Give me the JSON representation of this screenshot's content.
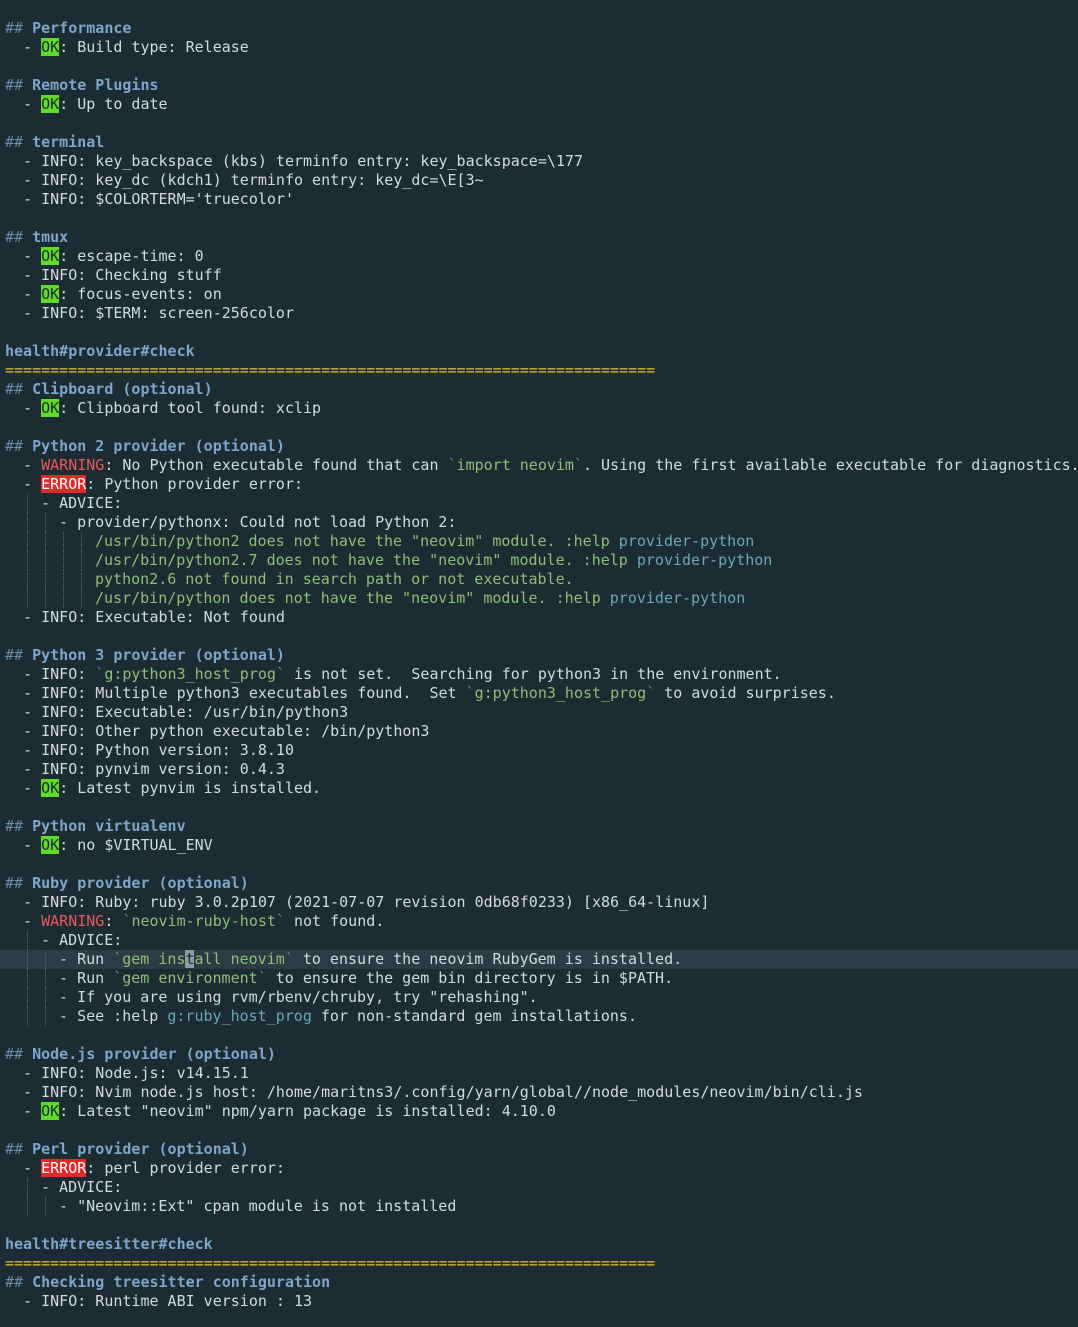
{
  "sections": {
    "performance": {
      "title": "Performance",
      "build_type": ": Build type: Release"
    },
    "remote_plugins": {
      "title": "Remote Plugins",
      "status": ": Up to date"
    },
    "terminal": {
      "title": "terminal",
      "lines": [
        "  - INFO: key_backspace (kbs) terminfo entry: key_backspace=\\177",
        "  - INFO: key_dc (kdch1) terminfo entry: key_dc=\\E[3~",
        "  - INFO: $COLORTERM='truecolor'"
      ]
    },
    "tmux": {
      "title": "tmux",
      "escape_time": ": escape-time: 0",
      "checking": "  - INFO: Checking stuff",
      "focus_events": ": focus-events: on",
      "term": "  - INFO: $TERM: screen-256color"
    },
    "provider_check": "health#provider#check",
    "rule": "========================================================================",
    "clipboard": {
      "title": "Clipboard (optional)",
      "found": ": Clipboard tool found: xclip"
    },
    "python2": {
      "title": "Python 2 provider (optional)",
      "warning_pre": ": No Python executable found that can ",
      "warning_code": "import neovim",
      "warning_post": ". Using the first available executable for diagnostics.",
      "error_text": ": Python provider error:",
      "advice": "ADVICE:",
      "could_not_load": "provider/pythonx: Could not load Python 2:",
      "details": [
        {
          "text": "/usr/bin/python2 does not have the \"neovim\" module. :help ",
          "tag": "provider-python"
        },
        {
          "text": "/usr/bin/python2.7 does not have the \"neovim\" module. :help ",
          "tag": "provider-python"
        },
        {
          "text": "python2.6 not found in search path or not executable.",
          "tag": ""
        },
        {
          "text": "/usr/bin/python does not have the \"neovim\" module. :help ",
          "tag": "provider-python"
        }
      ],
      "executable": "  - INFO: Executable: Not found"
    },
    "python3": {
      "title": "Python 3 provider (optional)",
      "host_prog": "g:python3_host_prog",
      "not_set": " is not set.  Searching for python3 in the environment.",
      "multiple": "  - INFO: Multiple python3 executables found.  Set ",
      "avoid": " to avoid surprises.",
      "executable": "  - INFO: Executable: /usr/bin/python3",
      "other": "  - INFO: Other python executable: /bin/python3",
      "version": "  - INFO: Python version: 3.8.10",
      "pynvim": "  - INFO: pynvim version: 0.4.3",
      "latest": ": Latest pynvim is installed."
    },
    "virtualenv": {
      "title": "Python virtualenv",
      "status": ": no $VIRTUAL_ENV"
    },
    "ruby": {
      "title": "Ruby provider (optional)",
      "ruby_info": "  - INFO: Ruby: ruby 3.0.2p107 (2021-07-07 revision 0db68f0233) [x86_64-linux]",
      "host_code": "neovim-ruby-host",
      "not_found": " not found.",
      "advice": "ADVICE:",
      "gem_install_a": "gem ins",
      "gem_install_cursor": "t",
      "gem_install_b": "all neovim",
      "gem_install_post": " to ensure the neovim RubyGem is installed.",
      "gem_env": "gem environment",
      "gem_env_post": " to ensure the gem bin directory is in $PATH.",
      "rehash": "If you are using rvm/rbenv/chruby, try \"rehashing\".",
      "see_help": "See :help ",
      "see_tag": "g:ruby_host_prog",
      "see_post": " for non-standard gem installations."
    },
    "node": {
      "title": "Node.js provider (optional)",
      "version": "  - INFO: Node.js: v14.15.1",
      "host": "  - INFO: Nvim node.js host: /home/maritns3/.config/yarn/global//node_modules/neovim/bin/cli.js",
      "latest": ": Latest \"neovim\" npm/yarn package is installed: 4.10.0"
    },
    "perl": {
      "title": "Perl provider (optional)",
      "error_text": ": perl provider error:",
      "advice": "ADVICE:",
      "module": "\"Neovim::Ext\" cpan module is not installed"
    },
    "treesitter_check": "health#treesitter#check",
    "treesitter": {
      "title": "Checking treesitter configuration",
      "abi": "  - INFO: Runtime ABI version : 13"
    }
  },
  "labels": {
    "hash": "## ",
    "ok": "OK",
    "error": "ERROR",
    "warning": "WARNING",
    "dash": "  - ",
    "info": "  - INFO: ",
    "run": "Run ",
    "backtick": "`"
  },
  "colors": {
    "background": "#1d2b33",
    "ok_badge": "#5fdc2a",
    "error_badge": "#e22a2a",
    "warning": "#e25a5a",
    "heading": "#7fa6c9",
    "rule": "#e3c23c",
    "code": "#8fbf76"
  }
}
